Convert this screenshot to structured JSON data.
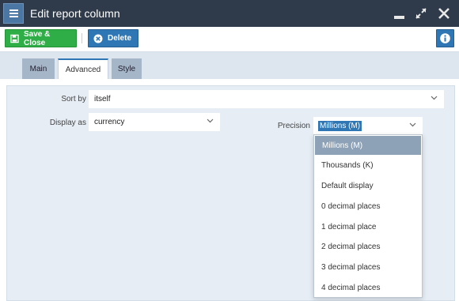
{
  "window": {
    "title": "Edit report column"
  },
  "toolbar": {
    "save_label": "Save & Close",
    "delete_label": "Delete"
  },
  "tabs": [
    {
      "label": "Main",
      "active": false
    },
    {
      "label": "Advanced",
      "active": true
    },
    {
      "label": "Style",
      "active": false
    }
  ],
  "form": {
    "sort_by": {
      "label": "Sort by",
      "value": "itself"
    },
    "display_as": {
      "label": "Display as",
      "value": "currency"
    },
    "precision": {
      "label": "Precision",
      "value": "Millions (M)"
    }
  },
  "precision_options": [
    "Millions (M)",
    "Thousands (K)",
    "Default display",
    "0 decimal places",
    "1 decimal place",
    "2 decimal places",
    "3 decimal places",
    "4 decimal places"
  ],
  "colors": {
    "titlebar": "#2f3b4a",
    "save": "#2fae47",
    "primary": "#2f76b4",
    "selected_option": "#8da2b7"
  }
}
